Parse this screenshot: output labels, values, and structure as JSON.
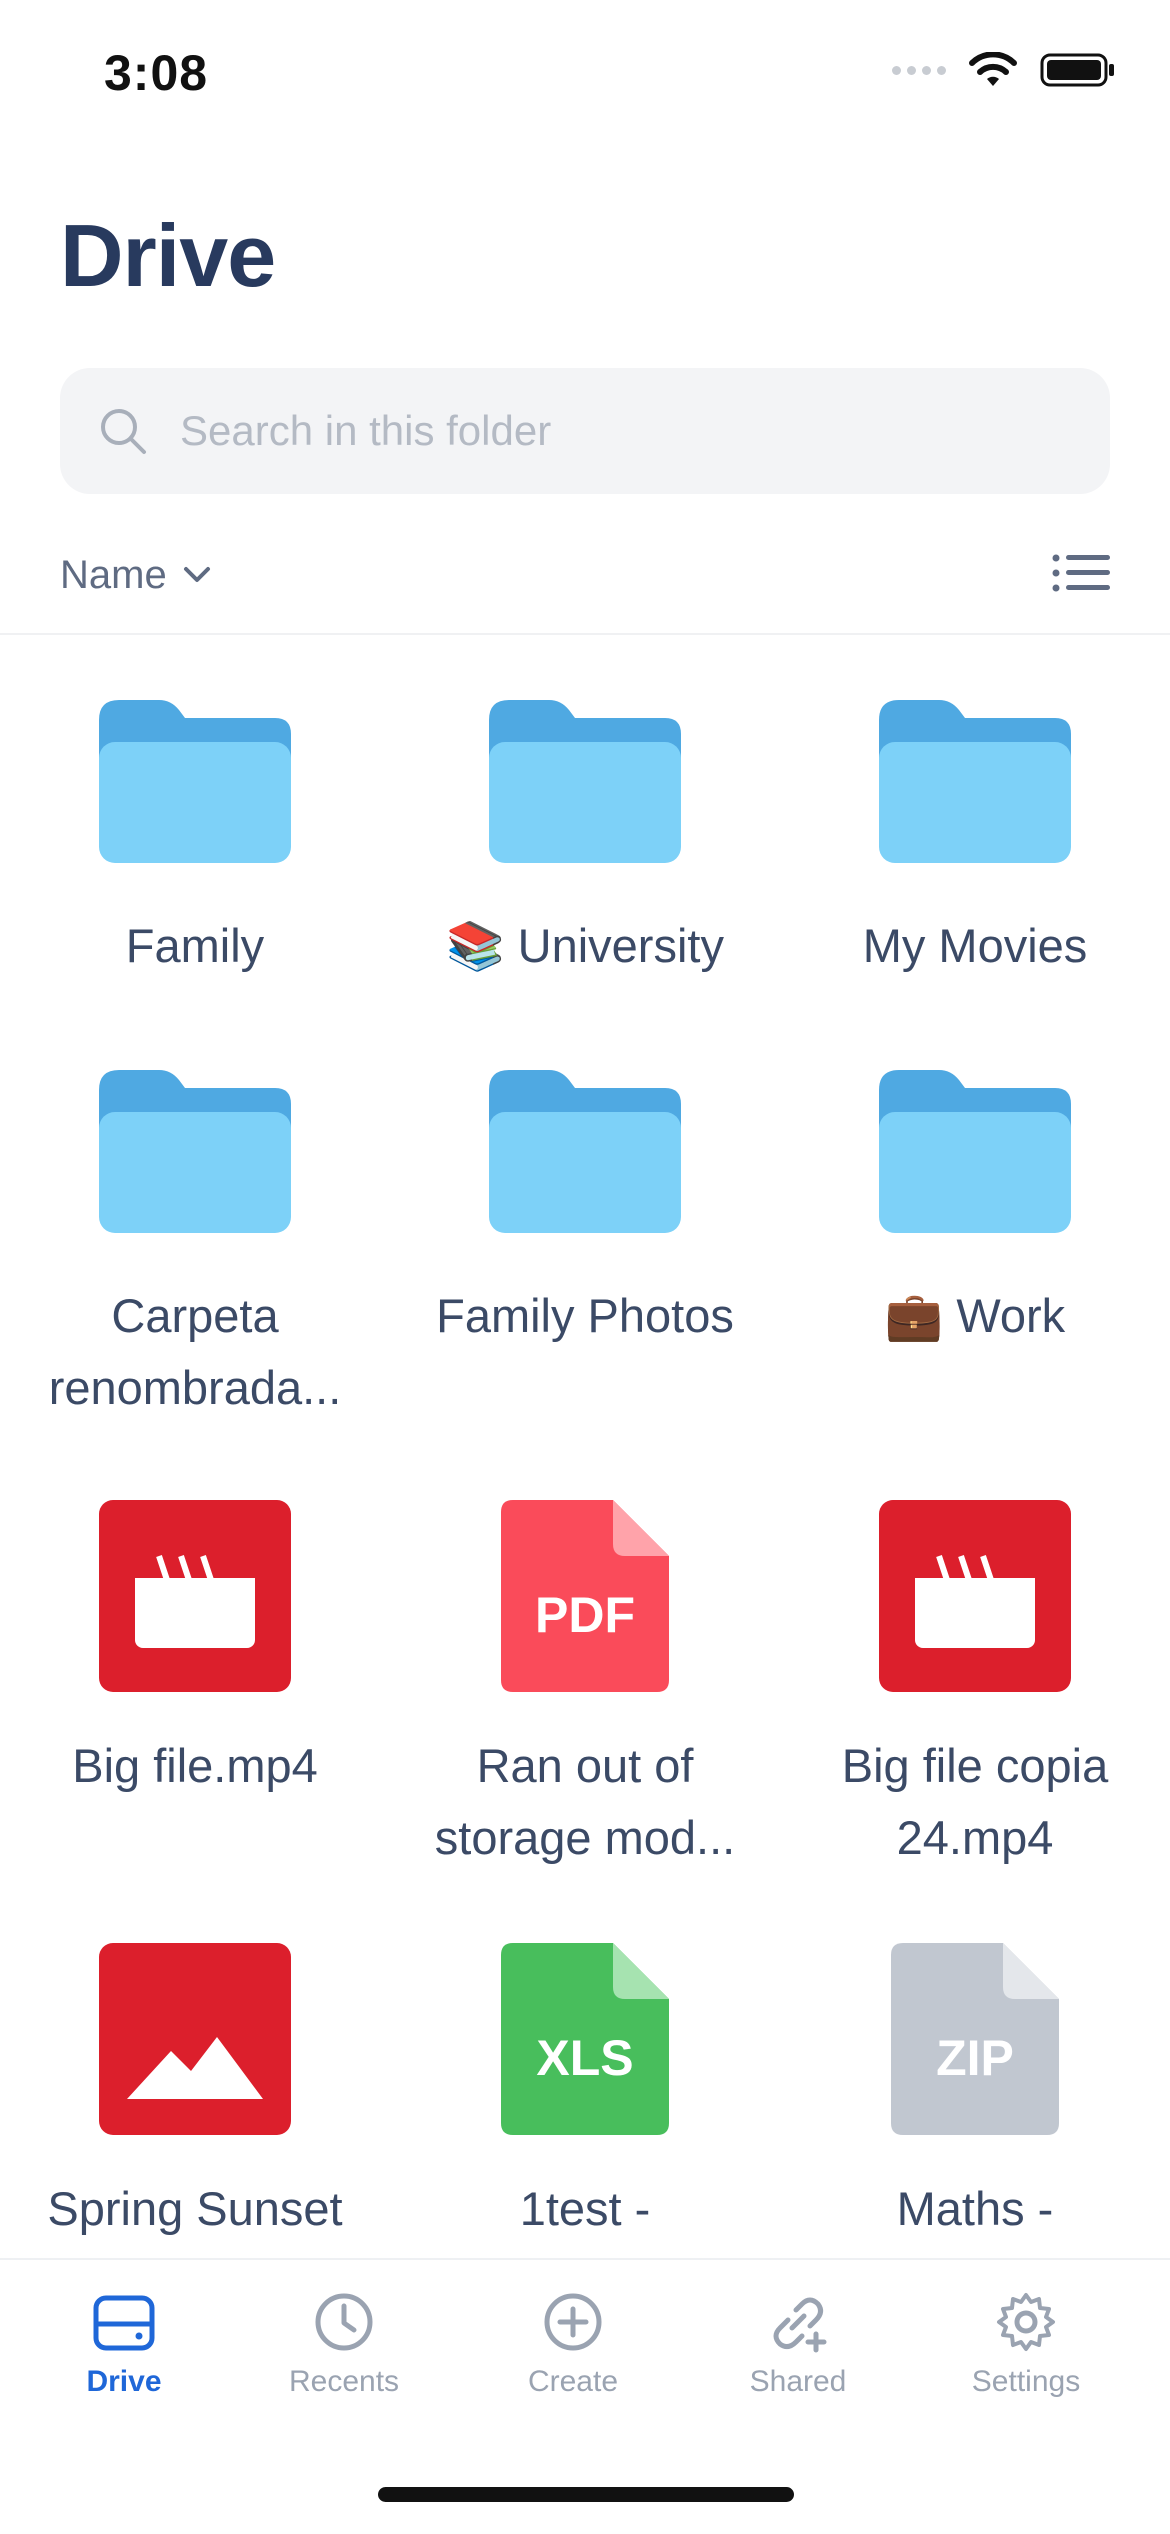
{
  "status_bar": {
    "time": "3:08"
  },
  "header": {
    "title": "Drive"
  },
  "search": {
    "placeholder": "Search in this folder"
  },
  "sort": {
    "label": "Name"
  },
  "items": [
    {
      "name": "Family",
      "type": "folder"
    },
    {
      "name": "📚 University",
      "type": "folder"
    },
    {
      "name": "My Movies",
      "type": "folder"
    },
    {
      "name": "Carpeta\nrenombrada...",
      "type": "folder"
    },
    {
      "name": "Family Photos",
      "type": "folder"
    },
    {
      "name": "💼 Work",
      "type": "folder"
    },
    {
      "name": "Big file.mp4",
      "type": "video"
    },
    {
      "name": "Ran out of\nstorage mod...",
      "type": "pdf",
      "badge": "PDF"
    },
    {
      "name": "Big file copia\n24.mp4",
      "type": "video"
    },
    {
      "name": "Spring Sunset",
      "type": "image"
    },
    {
      "name": "1test -",
      "type": "xls",
      "badge": "XLS"
    },
    {
      "name": "Maths -",
      "type": "zip",
      "badge": "ZIP"
    }
  ],
  "tabs": [
    {
      "label": "Drive",
      "icon": "drive-icon",
      "active": true
    },
    {
      "label": "Recents",
      "icon": "clock-icon",
      "active": false
    },
    {
      "label": "Create",
      "icon": "plus-circle-icon",
      "active": false
    },
    {
      "label": "Shared",
      "icon": "link-icon",
      "active": false
    },
    {
      "label": "Settings",
      "icon": "gear-icon",
      "active": false
    }
  ],
  "colors": {
    "accent": "#1f67d8",
    "folder": "#7dd1f8",
    "video": "#dc1f2c",
    "pdf": "#fa4b5a",
    "xls": "#48be5c",
    "zip": "#c1c7d0"
  }
}
